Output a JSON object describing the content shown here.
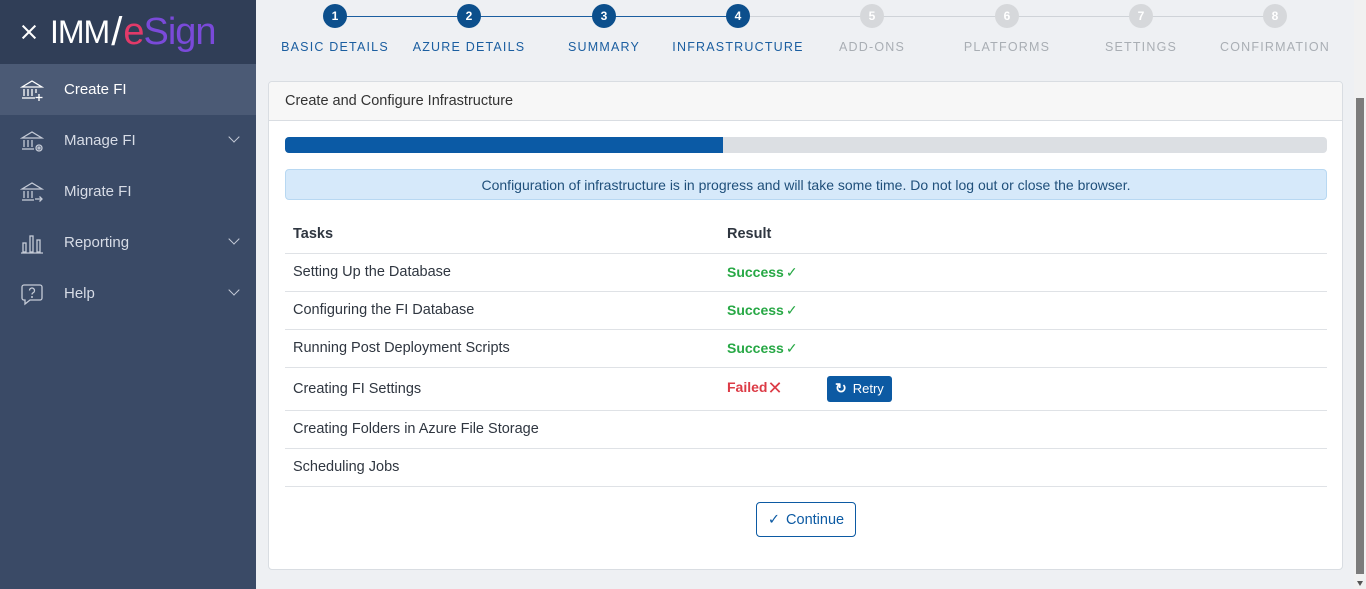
{
  "brand": {
    "part1": "IMM",
    "slash": "/",
    "part2": "e",
    "part3": "Sign"
  },
  "sidebar": {
    "items": [
      {
        "label": "Create FI",
        "icon": "bank-plus-icon"
      },
      {
        "label": "Manage FI",
        "icon": "bank-gear-icon"
      },
      {
        "label": "Migrate FI",
        "icon": "bank-arrow-icon"
      },
      {
        "label": "Reporting",
        "icon": "bar-chart-icon"
      },
      {
        "label": "Help",
        "icon": "help-bubble-icon"
      }
    ]
  },
  "stepper": {
    "steps": [
      {
        "num": "1",
        "label": "BASIC DETAILS"
      },
      {
        "num": "2",
        "label": "AZURE DETAILS"
      },
      {
        "num": "3",
        "label": "SUMMARY"
      },
      {
        "num": "4",
        "label": "INFRASTRUCTURE"
      },
      {
        "num": "5",
        "label": "ADD-ONS"
      },
      {
        "num": "6",
        "label": "PLATFORMS"
      },
      {
        "num": "7",
        "label": "SETTINGS"
      },
      {
        "num": "8",
        "label": "CONFIRMATION"
      }
    ],
    "current_step": 4
  },
  "card": {
    "title": "Create and Configure Infrastructure",
    "progress_fraction": 0.42,
    "alert": "Configuration of infrastructure is in progress and will take some time. Do not log out or close the browser.",
    "table": {
      "headers": [
        "Tasks",
        "Result"
      ],
      "rows": [
        {
          "task": "Setting Up the Database",
          "result": "Success",
          "mark": "✓"
        },
        {
          "task": "Configuring the FI Database",
          "result": "Success",
          "mark": "✓"
        },
        {
          "task": "Running Post Deployment Scripts",
          "result": "Success",
          "mark": "✓"
        },
        {
          "task": "Creating FI Settings",
          "result": "Failed",
          "mark": "✕",
          "action": "Retry"
        },
        {
          "task": "Creating Folders in Azure File Storage",
          "result": "",
          "mark": ""
        },
        {
          "task": "Scheduling Jobs",
          "result": "",
          "mark": ""
        }
      ]
    },
    "continue_label": "Continue"
  },
  "colors": {
    "primary": "#0c5aa3",
    "success": "#27a845",
    "danger": "#dc3b46",
    "sidebar": "#3a4a66"
  }
}
